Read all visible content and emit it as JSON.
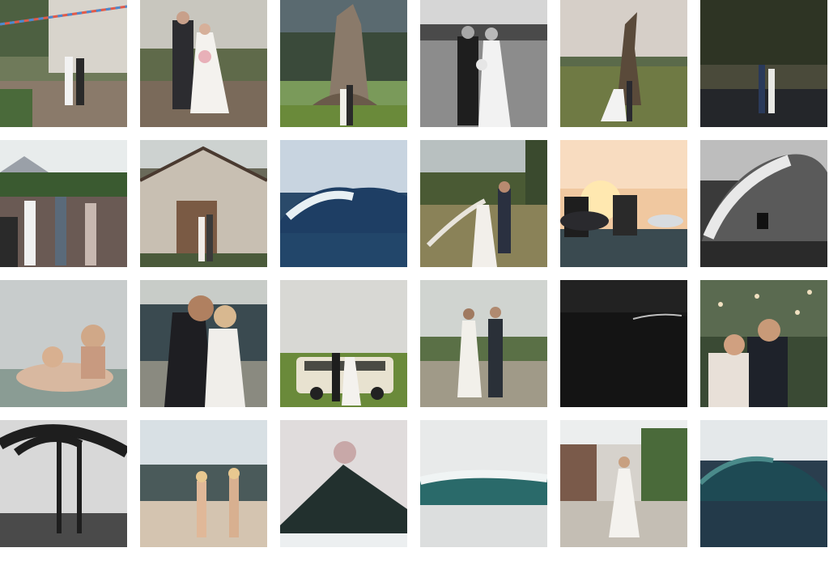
{
  "gallery": {
    "tiles": [
      {
        "subject": "wedding-house-bunting"
      },
      {
        "subject": "wedding-couple-garden"
      },
      {
        "subject": "wedding-couple-tree"
      },
      {
        "subject": "wedding-couple-bw-field"
      },
      {
        "subject": "wedding-couple-driftwood"
      },
      {
        "subject": "wedding-couple-water-night"
      },
      {
        "subject": "wedding-guests-celebration"
      },
      {
        "subject": "wedding-couple-old-barn"
      },
      {
        "subject": "ocean-wave-barrel"
      },
      {
        "subject": "wedding-couple-veil-field"
      },
      {
        "subject": "surfers-sunset"
      },
      {
        "subject": "surfer-bw-wave"
      },
      {
        "subject": "couple-in-water"
      },
      {
        "subject": "wedding-couple-kiss-beach"
      },
      {
        "subject": "wedding-couple-vw-van"
      },
      {
        "subject": "wedding-couple-coast-path"
      },
      {
        "subject": "dark-wave-bw"
      },
      {
        "subject": "wedding-confetti-exit"
      },
      {
        "subject": "palm-trees-bw"
      },
      {
        "subject": "couple-rocky-beach"
      },
      {
        "subject": "volcano-clouds"
      },
      {
        "subject": "ocean-wave-break"
      },
      {
        "subject": "bride-garden-path"
      },
      {
        "subject": "ocean-wave-teal"
      }
    ]
  }
}
